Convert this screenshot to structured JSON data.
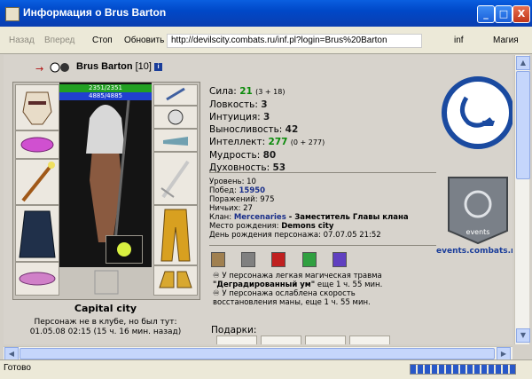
{
  "window": {
    "title": "Информация о Brus Barton",
    "minimize": "_",
    "maximize": "□",
    "close": "X"
  },
  "toolbar": {
    "back": "Назад",
    "forward": "Вперед",
    "stop": "Стоп",
    "refresh": "Обновить",
    "address": "http://devilscity.combats.ru/inf.pl?login=Brus%20Barton",
    "inf": "inf",
    "magic": "Магия"
  },
  "character": {
    "name": "Brus Barton",
    "level": "[10]",
    "info_icon": "i",
    "hp": "2351/2351",
    "mana": "4885/4885",
    "city": "Capital city",
    "online_line1": "Персонаж не в клубе, но был тут:",
    "online_line2": "01.05.08 02:15 (15 ч. 16 мин. назад)"
  },
  "stats": {
    "strength_label": "Сила:",
    "strength_value": "21",
    "strength_extra": "(3 + 18)",
    "agility_label": "Ловкость:",
    "agility_value": "3",
    "intuition_label": "Интуиция:",
    "intuition_value": "3",
    "endurance_label": "Выносливость:",
    "endurance_value": "42",
    "intellect_label": "Интеллект:",
    "intellect_value": "277",
    "intellect_extra": "(0 + 277)",
    "wisdom_label": "Мудрость:",
    "wisdom_value": "80",
    "spirit_label": "Духовность:",
    "spirit_value": "53"
  },
  "info": {
    "level": "Уровень: 10",
    "wins_label": "Побед: ",
    "wins": "15950",
    "losses": "Поражений: 975",
    "draws": "Ничьих: 27",
    "clan_label": "Клан: ",
    "clan_name": "Mercenaries",
    "clan_role": " - Заместитель Главы клана",
    "birthplace_label": "Место рождения: ",
    "birthplace": "Demons city",
    "birthday": "День рождения персонажа: 07.07.05 21:52"
  },
  "trauma": {
    "line1": "У персонажа легкая магическая травма",
    "line2_bold": "\"Деградированный ум\"",
    "line2_rest": " еще 1 ч. 55 мин.",
    "line3": "У персонажа ослаблена скорость",
    "line4": "восстановления маны, еще 1 ч. 55 мин."
  },
  "gifts_label": "Подарки:",
  "events_link": "events.combats.ru",
  "events_logo_text": "events",
  "status": {
    "text": "Готово"
  },
  "colors": {
    "titlebar": "#0048c8",
    "hp": "#22a022",
    "mana": "#2040d0",
    "stat_green": "#0a8a0a",
    "link_blue": "#1a3d9a"
  }
}
